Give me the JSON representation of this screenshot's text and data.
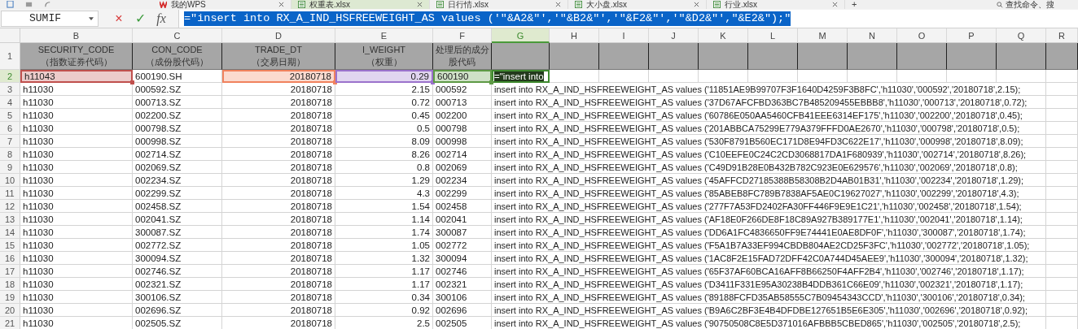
{
  "tabs": [
    {
      "label": "我的WPS",
      "kind": "home",
      "selected": false
    },
    {
      "label": "权重表.xlsx",
      "kind": "sheet",
      "selected": true
    },
    {
      "label": "日行情.xlsx",
      "kind": "sheet",
      "selected": false
    },
    {
      "label": "大小盘.xlsx",
      "kind": "sheet",
      "selected": false
    },
    {
      "label": "行业.xlsx",
      "kind": "sheet",
      "selected": false
    }
  ],
  "new_tab": "+",
  "command_search": {
    "placeholder": "查找命令、搜"
  },
  "name_box": "SUMIF",
  "formula_buttons": [
    "×",
    "✓",
    "fx"
  ],
  "formula": "=\"insert into RX_A_IND_HSFREEWEIGHT_AS values ('\"&A2&\"','\"&B2&\"','\"&F2&\"','\"&D2&\"',\"&E2&\");\"",
  "columns": [
    {
      "label": "B",
      "selected": false
    },
    {
      "label": "C",
      "selected": false
    },
    {
      "label": "D",
      "selected": false
    },
    {
      "label": "E",
      "selected": false
    },
    {
      "label": "F",
      "selected": false
    },
    {
      "label": "G",
      "selected": true
    },
    {
      "label": "H",
      "selected": false
    },
    {
      "label": "I",
      "selected": false
    },
    {
      "label": "J",
      "selected": false
    },
    {
      "label": "K",
      "selected": false
    },
    {
      "label": "L",
      "selected": false
    },
    {
      "label": "M",
      "selected": false
    },
    {
      "label": "N",
      "selected": false
    },
    {
      "label": "O",
      "selected": false
    },
    {
      "label": "P",
      "selected": false
    },
    {
      "label": "Q",
      "selected": false
    },
    {
      "label": "R",
      "selected": false
    }
  ],
  "header_row": {
    "number": "1",
    "cells": [
      {
        "title": "SECURITY_CODE",
        "subtitle": "（指数证券代码）"
      },
      {
        "title": "CON_CODE",
        "subtitle": "（成份股代码）"
      },
      {
        "title": "TRADE_DT",
        "subtitle": "（交易日期）"
      },
      {
        "title": "I_WEIGHT",
        "subtitle": "（权重）"
      },
      {
        "title": "处理后的成分股代码"
      }
    ]
  },
  "rows": [
    {
      "number": "2",
      "selected": true,
      "cells": [
        {
          "text": "h11043",
          "color": "#c0504d"
        },
        {
          "text": "600190.SH"
        },
        {
          "text": "20180718",
          "color": "#f0825e"
        },
        {
          "text": "0.29",
          "color": "#9b72cc"
        },
        {
          "text": "600190",
          "color": "#5e9a45"
        },
        {
          "text": "=\"insert into"
        }
      ]
    },
    {
      "number": "3",
      "selected": false,
      "cells": [
        "h11030",
        "000592.SZ",
        "20180718",
        "2.15",
        "000592",
        "insert into RX_A_IND_HSFREEWEIGHT_AS values ('11851AE9B99707F3F1640D4259F3B8FC','h11030','000592','20180718',2.15);"
      ]
    },
    {
      "number": "4",
      "selected": false,
      "cells": [
        "h11030",
        "000713.SZ",
        "20180718",
        "0.72",
        "000713",
        "insert into RX_A_IND_HSFREEWEIGHT_AS values ('37D67AFCFBD363BC7B485209455EBBB8','h11030','000713','20180718',0.72);"
      ]
    },
    {
      "number": "5",
      "selected": false,
      "cells": [
        "h11030",
        "002200.SZ",
        "20180718",
        "0.45",
        "002200",
        "insert into RX_A_IND_HSFREEWEIGHT_AS values ('60786E050AA5460CFB41EEE6314EF175','h11030','002200','20180718',0.45);"
      ]
    },
    {
      "number": "6",
      "selected": false,
      "cells": [
        "h11030",
        "000798.SZ",
        "20180718",
        "0.5",
        "000798",
        "insert into RX_A_IND_HSFREEWEIGHT_AS values ('201ABBCA75299E779A379FFFD0AE2670','h11030','000798','20180718',0.5);"
      ]
    },
    {
      "number": "7",
      "selected": false,
      "cells": [
        "h11030",
        "000998.SZ",
        "20180718",
        "8.09",
        "000998",
        "insert into RX_A_IND_HSFREEWEIGHT_AS values ('530F8791B560EC171D8E94FD3C622E17','h11030','000998','20180718',8.09);"
      ]
    },
    {
      "number": "8",
      "selected": false,
      "cells": [
        "h11030",
        "002714.SZ",
        "20180718",
        "8.26",
        "002714",
        "insert into RX_A_IND_HSFREEWEIGHT_AS values ('C10EEFE0C24C2CD3068817DA1F680939','h11030','002714','20180718',8.26);"
      ]
    },
    {
      "number": "9",
      "selected": false,
      "cells": [
        "h11030",
        "002069.SZ",
        "20180718",
        "0.8",
        "002069",
        "insert into RX_A_IND_HSFREEWEIGHT_AS values ('C49D91B28E0B432B782C923E0E629576','h11030','002069','20180718',0.8);"
      ]
    },
    {
      "number": "10",
      "selected": false,
      "cells": [
        "h11030",
        "002234.SZ",
        "20180718",
        "1.29",
        "002234",
        "insert into RX_A_IND_HSFREEWEIGHT_AS values ('45AFFCD27185388B58308B2D4AB01B31','h11030','002234','20180718',1.29);"
      ]
    },
    {
      "number": "11",
      "selected": false,
      "cells": [
        "h11030",
        "002299.SZ",
        "20180718",
        "4.3",
        "002299",
        "insert into RX_A_IND_HSFREEWEIGHT_AS values ('85ABEB8FC789B7838AF5AE0C19627027','h11030','002299','20180718',4.3);"
      ]
    },
    {
      "number": "12",
      "selected": false,
      "cells": [
        "h11030",
        "002458.SZ",
        "20180718",
        "1.54",
        "002458",
        "insert into RX_A_IND_HSFREEWEIGHT_AS values ('277F7A53FD2402FA30FF446F9E9E1C21','h11030','002458','20180718',1.54);"
      ]
    },
    {
      "number": "13",
      "selected": false,
      "cells": [
        "h11030",
        "002041.SZ",
        "20180718",
        "1.14",
        "002041",
        "insert into RX_A_IND_HSFREEWEIGHT_AS values ('AF18E0F266DE8F18C89A927B389177E1','h11030','002041','20180718',1.14);"
      ]
    },
    {
      "number": "14",
      "selected": false,
      "cells": [
        "h11030",
        "300087.SZ",
        "20180718",
        "1.74",
        "300087",
        "insert into RX_A_IND_HSFREEWEIGHT_AS values ('DD6A1FC4836650FF9E74441E0AE8DF0F','h11030','300087','20180718',1.74);"
      ]
    },
    {
      "number": "15",
      "selected": false,
      "cells": [
        "h11030",
        "002772.SZ",
        "20180718",
        "1.05",
        "002772",
        "insert into RX_A_IND_HSFREEWEIGHT_AS values ('F5A1B7A33EF994CBDB804AE2CD25F3FC','h11030','002772','20180718',1.05);"
      ]
    },
    {
      "number": "16",
      "selected": false,
      "cells": [
        "h11030",
        "300094.SZ",
        "20180718",
        "1.32",
        "300094",
        "insert into RX_A_IND_HSFREEWEIGHT_AS values ('1AC8F2E15FAD72DFF42C0A744D45AEE9','h11030','300094','20180718',1.32);"
      ]
    },
    {
      "number": "17",
      "selected": false,
      "cells": [
        "h11030",
        "002746.SZ",
        "20180718",
        "1.17",
        "002746",
        "insert into RX_A_IND_HSFREEWEIGHT_AS values ('65F37AF60BCA16AFF8B66250F4AFF2B4','h11030','002746','20180718',1.17);"
      ]
    },
    {
      "number": "18",
      "selected": false,
      "cells": [
        "h11030",
        "002321.SZ",
        "20180718",
        "1.17",
        "002321",
        "insert into RX_A_IND_HSFREEWEIGHT_AS values ('D3411F331E95A30238B4DDB361C66E09','h11030','002321','20180718',1.17);"
      ]
    },
    {
      "number": "19",
      "selected": false,
      "cells": [
        "h11030",
        "300106.SZ",
        "20180718",
        "0.34",
        "300106",
        "insert into RX_A_IND_HSFREEWEIGHT_AS values ('89188FCFD35AB58555C7B09454343CCD','h11030','300106','20180718',0.34);"
      ]
    },
    {
      "number": "20",
      "selected": false,
      "cells": [
        "h11030",
        "002696.SZ",
        "20180718",
        "0.92",
        "002696",
        "insert into RX_A_IND_HSFREEWEIGHT_AS values ('B9A6C2BF3E4B4DFDBE127651B5E6E305','h11030','002696','20180718',0.92);"
      ]
    },
    {
      "number": "21",
      "selected": false,
      "cells": [
        "h11030",
        "002505.SZ",
        "20180718",
        "2.5",
        "002505",
        "insert into RX_A_IND_HSFREEWEIGHT_AS values ('90750508C8E5D371016AFBBB5CBED865','h11030','002505','20180718',2.5);"
      ]
    }
  ]
}
